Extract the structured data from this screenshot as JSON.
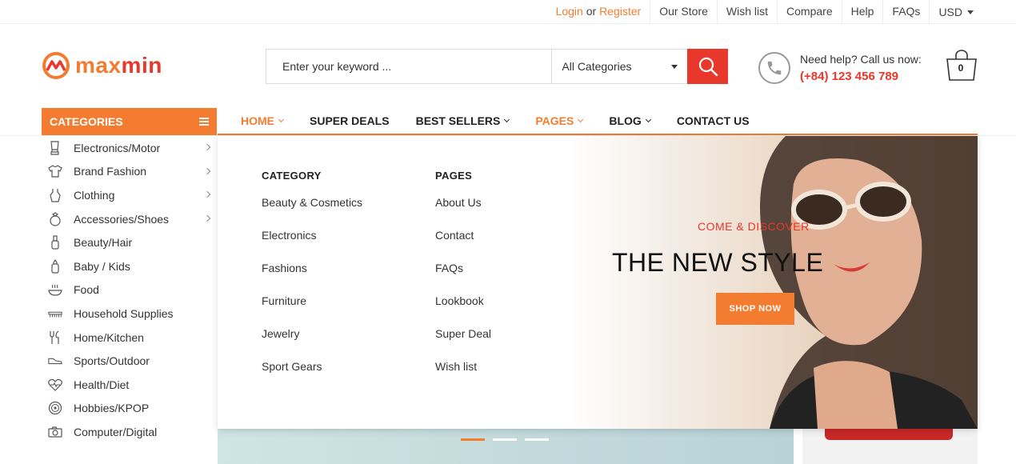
{
  "topbar": {
    "login": "Login",
    "or": "or",
    "register": "Register",
    "links": [
      "Our Store",
      "Wish list",
      "Compare",
      "Help",
      "FAQs"
    ],
    "currency": "USD"
  },
  "brand": {
    "max": "max",
    "min": "min"
  },
  "search": {
    "placeholder": "Enter your keyword ...",
    "category": "All Categories"
  },
  "help": {
    "label": "Need help? Call us now:",
    "phone": "(+84) 123 456 789"
  },
  "cart": {
    "count": "0"
  },
  "categories_label": "CATEGORIES",
  "nav": [
    {
      "label": "HOME",
      "active": true,
      "dropdown": true
    },
    {
      "label": "SUPER DEALS",
      "active": false,
      "dropdown": false
    },
    {
      "label": "BEST SELLERS",
      "active": false,
      "dropdown": true
    },
    {
      "label": "PAGES",
      "active": true,
      "dropdown": true
    },
    {
      "label": "BLOG",
      "active": false,
      "dropdown": true
    },
    {
      "label": "CONTACT US",
      "active": false,
      "dropdown": false
    }
  ],
  "sidebar": [
    {
      "label": "Electronics/Motor",
      "icon": "blender-icon",
      "arrow": true
    },
    {
      "label": "Brand Fashion",
      "icon": "shirt-icon",
      "arrow": true
    },
    {
      "label": "Clothing",
      "icon": "dress-icon",
      "arrow": true
    },
    {
      "label": "Accessories/Shoes",
      "icon": "ring-icon",
      "arrow": true
    },
    {
      "label": "Beauty/Hair",
      "icon": "bottle-icon",
      "arrow": false
    },
    {
      "label": "Baby / Kids",
      "icon": "baby-bottle-icon",
      "arrow": false
    },
    {
      "label": "Food",
      "icon": "food-icon",
      "arrow": false
    },
    {
      "label": "Household Supplies",
      "icon": "comb-icon",
      "arrow": false
    },
    {
      "label": "Home/Kitchen",
      "icon": "utensils-icon",
      "arrow": false
    },
    {
      "label": "Sports/Outdoor",
      "icon": "shoe-icon",
      "arrow": false
    },
    {
      "label": "Health/Diet",
      "icon": "heart-pulse-icon",
      "arrow": false
    },
    {
      "label": "Hobbies/KPOP",
      "icon": "vinyl-icon",
      "arrow": false
    },
    {
      "label": "Computer/Digital",
      "icon": "camera-icon",
      "arrow": false
    }
  ],
  "mega": {
    "col1": {
      "title": "CATEGORY",
      "links": [
        "Beauty & Cosmetics",
        "Electronics",
        "Fashions",
        "Furniture",
        "Jewelry",
        "Sport Gears"
      ]
    },
    "col2": {
      "title": "PAGES",
      "links": [
        "About Us",
        "Contact",
        "FAQs",
        "Lookbook",
        "Super Deal",
        "Wish list"
      ]
    }
  },
  "banner": {
    "subtitle": "COME & DISCOVER",
    "title": "THE NEW STYLE",
    "button": "SHOP NOW"
  },
  "colors": {
    "accent": "#f47c30",
    "red": "#e8372b"
  }
}
